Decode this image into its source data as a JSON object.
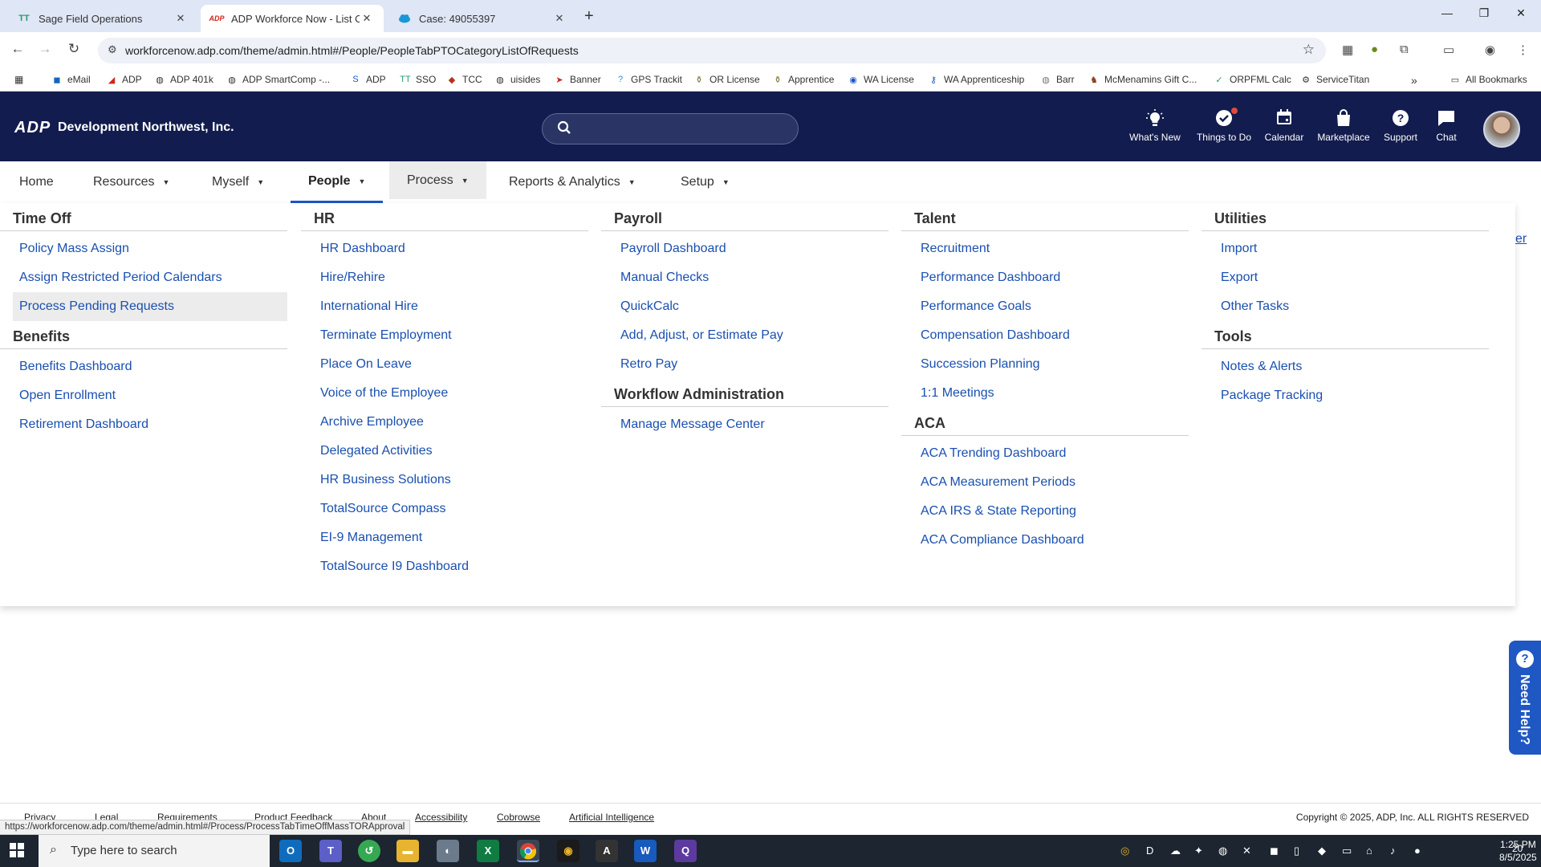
{
  "browser": {
    "tabs": [
      {
        "favicon": "TT",
        "title": "Sage Field Operations",
        "close": "✕"
      },
      {
        "favicon": "ADP",
        "title": "ADP Workforce Now - List Of R",
        "close": "✕"
      },
      {
        "favicon": "cloud-icon",
        "title": "Case: 49055397",
        "close": "✕"
      }
    ],
    "new_tab": "+",
    "url": "workforcenow.adp.com/theme/admin.html#/People/PeopleTabPTOCategoryListOfRequests",
    "bookmarks": [
      "eMail",
      "ADP",
      "ADP 401k",
      "ADP SmartComp -...",
      "ADP",
      "SSO",
      "TCC",
      "uisides",
      "Banner",
      "GPS Trackit",
      "OR License",
      "Apprentice",
      "WA License",
      "WA Apprenticeship",
      "Barr",
      "McMenamins Gift C...",
      "ORPFML Calc",
      "ServiceTitan"
    ],
    "more": "»",
    "all_bookmarks": "All Bookmarks"
  },
  "header": {
    "logo": "ADP",
    "company": "Development Northwest, Inc.",
    "search_placeholder": "",
    "items": [
      "What's New",
      "Things to Do",
      "Calendar",
      "Marketplace",
      "Support",
      "Chat"
    ]
  },
  "nav": {
    "items": [
      "Home",
      "Resources",
      "Myself",
      "People",
      "Process",
      "Reports & Analytics",
      "Setup"
    ]
  },
  "menu": {
    "time_off": {
      "title": "Time Off",
      "links": [
        "Policy Mass Assign",
        "Assign Restricted Period Calendars",
        "Process Pending Requests"
      ]
    },
    "benefits": {
      "title": "Benefits",
      "links": [
        "Benefits Dashboard",
        "Open Enrollment",
        "Retirement Dashboard"
      ]
    },
    "hr": {
      "title": "HR",
      "links": [
        "HR Dashboard",
        "Hire/Rehire",
        "International Hire",
        "Terminate Employment",
        "Place On Leave",
        "Voice of the Employee",
        "Archive Employee",
        "Delegated Activities",
        "HR Business Solutions",
        "TotalSource Compass",
        "EI-9 Management",
        "TotalSource I9 Dashboard"
      ]
    },
    "payroll": {
      "title": "Payroll",
      "links": [
        "Payroll Dashboard",
        "Manual Checks",
        "QuickCalc",
        "Add, Adjust, or Estimate Pay",
        "Retro Pay"
      ]
    },
    "workflow": {
      "title": "Workflow Administration",
      "links": [
        "Manage Message Center"
      ]
    },
    "talent": {
      "title": "Talent",
      "links": [
        "Recruitment",
        "Performance Dashboard",
        "Performance Goals",
        "Compensation Dashboard",
        "Succession Planning",
        "1:1 Meetings"
      ]
    },
    "aca": {
      "title": "ACA",
      "links": [
        "ACA Trending Dashboard",
        "ACA Measurement Periods",
        "ACA IRS & State Reporting",
        "ACA Compliance Dashboard"
      ]
    },
    "utilities": {
      "title": "Utilities",
      "links": [
        "Import",
        "Export",
        "Other Tasks"
      ]
    },
    "tools": {
      "title": "Tools",
      "links": [
        "Notes & Alerts",
        "Package Tracking"
      ]
    }
  },
  "background_link": "er",
  "need_help": "Need Help?",
  "footer": {
    "links": [
      "Privacy",
      "Legal",
      "Requirements",
      "Product Feedback",
      "About",
      "Accessibility",
      "Cobrowse",
      "Artificial Intelligence"
    ],
    "copyright": "Copyright © 2025, ADP, Inc. ALL RIGHTS RESERVED",
    "status_url": "https://workforcenow.adp.com/theme/admin.html#/Process/ProcessTabTimeOffMassTORApproval"
  },
  "taskbar": {
    "search_text": "Type here to search",
    "time": "1:25 PM",
    "date": "8/5/2025",
    "notification_count": "20"
  }
}
